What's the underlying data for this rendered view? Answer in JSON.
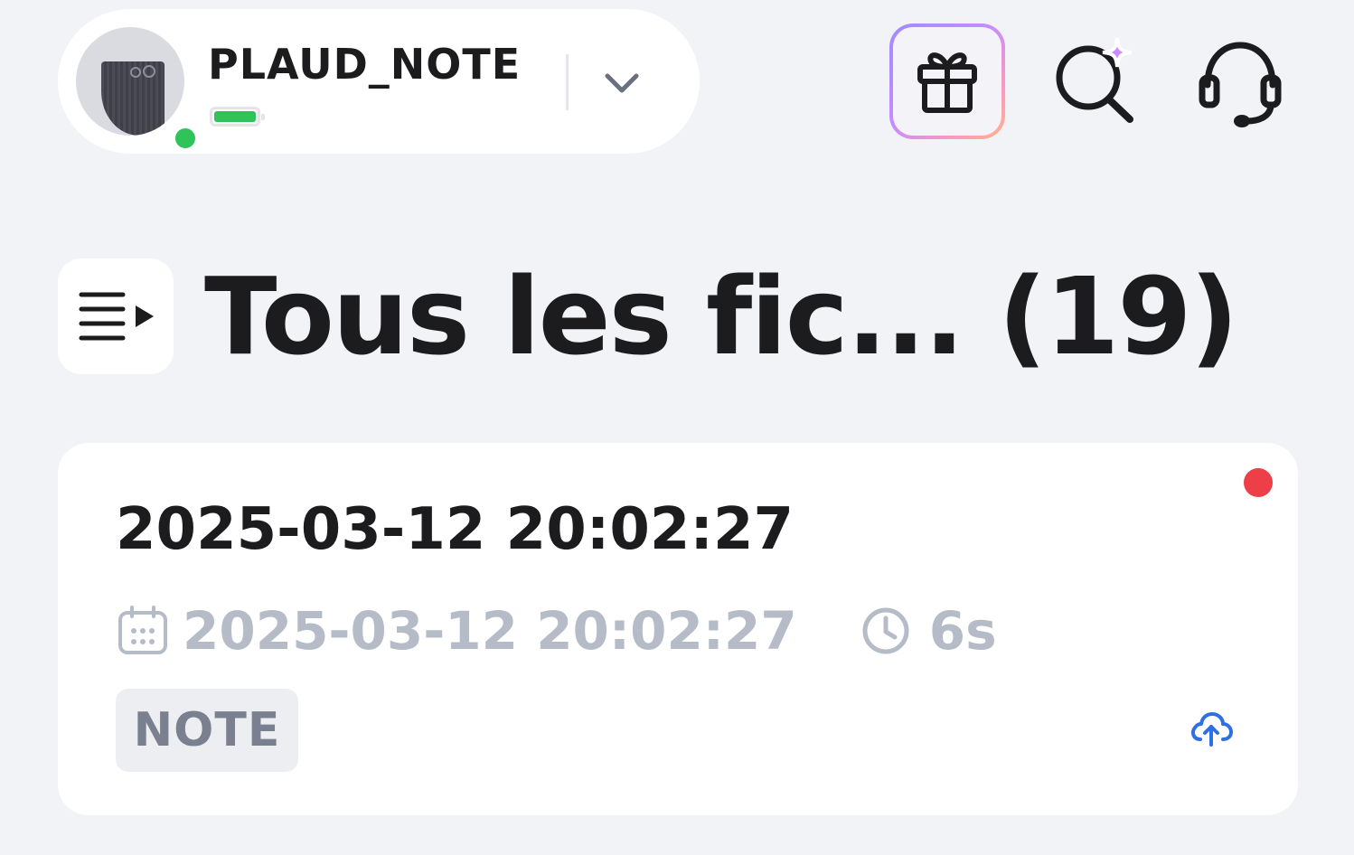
{
  "device": {
    "name": "PLAUD_NOTE",
    "status": "online",
    "battery_level": 1.0
  },
  "header": {
    "icons": [
      "gift-icon",
      "ai-search-icon",
      "headset-icon"
    ]
  },
  "page": {
    "title": "Tous les fic... (19)"
  },
  "recordings": [
    {
      "title": "2025-03-12 20:02:27",
      "date": "2025-03-12 20:02:27",
      "duration": "6s",
      "tag": "NOTE",
      "unread": true
    }
  ],
  "colors": {
    "background": "#f2f3f7",
    "online": "#2ec45a",
    "unread": "#ee3e48",
    "upload": "#2f6fe4",
    "muted_text": "#b5bcc8"
  }
}
